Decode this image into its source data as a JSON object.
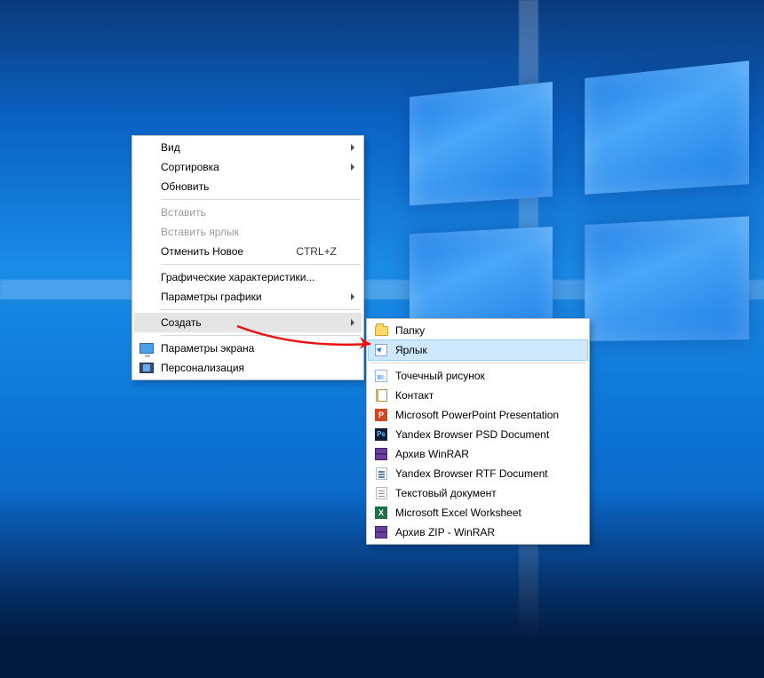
{
  "context_menu": {
    "groups": [
      [
        {
          "label": "Вид",
          "arrow": true,
          "enabled": true
        },
        {
          "label": "Сортировка",
          "arrow": true,
          "enabled": true
        },
        {
          "label": "Обновить",
          "arrow": false,
          "enabled": true
        }
      ],
      [
        {
          "label": "Вставить",
          "arrow": false,
          "enabled": false
        },
        {
          "label": "Вставить ярлык",
          "arrow": false,
          "enabled": false
        },
        {
          "label": "Отменить Новое",
          "arrow": false,
          "enabled": true,
          "shortcut": "CTRL+Z"
        }
      ],
      [
        {
          "label": "Графические характеристики...",
          "arrow": false,
          "enabled": true
        },
        {
          "label": "Параметры графики",
          "arrow": true,
          "enabled": true
        }
      ],
      [
        {
          "label": "Создать",
          "arrow": true,
          "enabled": true,
          "highlight": true
        }
      ],
      [
        {
          "label": "Параметры экрана",
          "arrow": false,
          "enabled": true,
          "icon": "display-icon"
        },
        {
          "label": "Персонализация",
          "arrow": false,
          "enabled": true,
          "icon": "personalize-icon"
        }
      ]
    ]
  },
  "submenu_new": {
    "items": [
      {
        "label": "Папку",
        "icon": "folder-icon",
        "selected": false
      },
      {
        "label": "Ярлык",
        "icon": "shortcut-icon",
        "selected": true,
        "sep_after": true
      },
      {
        "label": "Точечный рисунок",
        "icon": "bitmap-icon"
      },
      {
        "label": "Контакт",
        "icon": "contact-icon"
      },
      {
        "label": "Microsoft PowerPoint Presentation",
        "icon": "powerpoint-icon"
      },
      {
        "label": "Yandex Browser PSD Document",
        "icon": "psd-icon"
      },
      {
        "label": "Архив WinRAR",
        "icon": "winrar-icon"
      },
      {
        "label": "Yandex Browser RTF Document",
        "icon": "rtf-icon"
      },
      {
        "label": "Текстовый документ",
        "icon": "text-icon"
      },
      {
        "label": "Microsoft Excel Worksheet",
        "icon": "excel-icon"
      },
      {
        "label": "Архив ZIP - WinRAR",
        "icon": "winrar-icon"
      }
    ]
  }
}
